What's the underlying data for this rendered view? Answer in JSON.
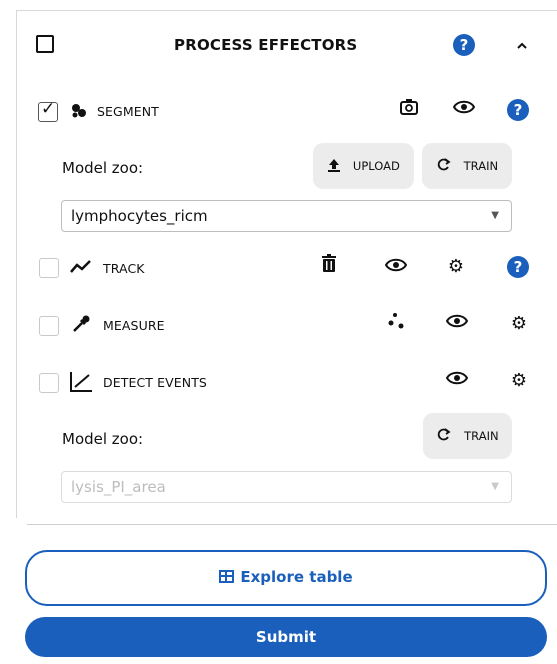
{
  "header": {
    "title": "PROCESS EFFECTORS",
    "help_glyph": "?",
    "collapse_glyph": "^"
  },
  "rows": {
    "segment": {
      "label": "SEGMENT",
      "checked": true,
      "help_glyph": "?"
    },
    "track": {
      "label": "TRACK",
      "checked": false,
      "help_glyph": "?"
    },
    "measure": {
      "label": "MEASURE",
      "checked": false
    },
    "detect_events": {
      "label": "DETECT EVENTS",
      "checked": false
    }
  },
  "segment_zoo": {
    "label": "Model zoo:",
    "upload_label": "UPLOAD",
    "train_label": "TRAIN",
    "selected": "lymphocytes_ricm"
  },
  "events_zoo": {
    "label": "Model zoo:",
    "train_label": "TRAIN",
    "selected": "lysis_PI_area",
    "disabled": true
  },
  "explore_label": "Explore table",
  "submit_label": "Submit",
  "icons": [
    "checkbox-icon",
    "help-icon",
    "chevron-up-icon",
    "segment-icon",
    "camera-refresh-icon",
    "eye-icon",
    "track-icon",
    "trash-icon",
    "gear-icon",
    "pipette-icon",
    "scatter-dots-icon",
    "chart-line-icon",
    "upload-icon",
    "redo-icon",
    "caret-down-icon",
    "table-icon"
  ],
  "colors": {
    "accent": "#1b5fbd",
    "button_bg": "#ececec",
    "border": "#d8d8d8"
  }
}
